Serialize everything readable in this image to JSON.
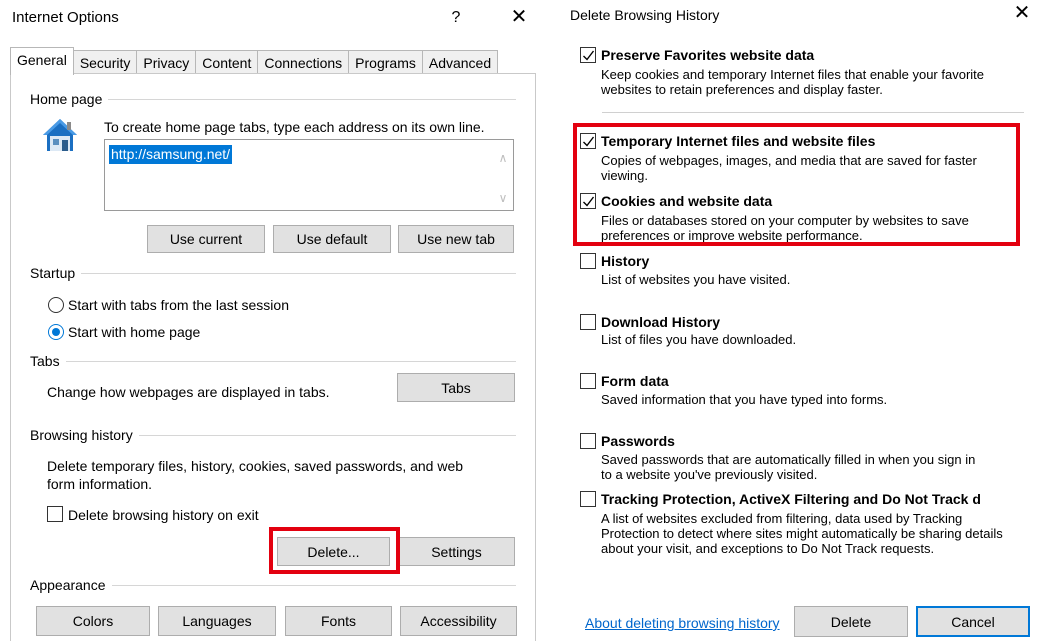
{
  "internet_options": {
    "title": "Internet Options",
    "help_glyph": "?",
    "close_glyph": "✕",
    "tabs": [
      {
        "label": "General"
      },
      {
        "label": "Security"
      },
      {
        "label": "Privacy"
      },
      {
        "label": "Content"
      },
      {
        "label": "Connections"
      },
      {
        "label": "Programs"
      },
      {
        "label": "Advanced"
      }
    ],
    "home_page": {
      "group_label": "Home page",
      "instruction": "To create home page tabs, type each address on its own line.",
      "url_value": "http://samsung.net/",
      "use_current": "Use current",
      "use_default": "Use default",
      "use_new_tab": "Use new tab"
    },
    "startup": {
      "group_label": "Startup",
      "option_last_session": "Start with tabs from the last session",
      "option_home_page": "Start with home page"
    },
    "tabs_group": {
      "group_label": "Tabs",
      "description": "Change how webpages are displayed in tabs.",
      "button": "Tabs"
    },
    "browsing_history": {
      "group_label": "Browsing history",
      "description_line1": "Delete temporary files, history, cookies, saved passwords, and web",
      "description_line2": "form information.",
      "delete_on_exit": "Delete browsing history on exit",
      "delete_button": "Delete...",
      "settings_button": "Settings"
    },
    "appearance": {
      "group_label": "Appearance",
      "colors": "Colors",
      "languages": "Languages",
      "fonts": "Fonts",
      "accessibility": "Accessibility"
    }
  },
  "delete_browsing_history": {
    "title": "Delete Browsing History",
    "close_glyph": "✕",
    "options": [
      {
        "label": "Preserve Favorites website data",
        "checked": true,
        "desc1": "Keep cookies and temporary Internet files that enable your favorite",
        "desc2": "websites to retain preferences and display faster."
      },
      {
        "label": "Temporary Internet files and website files",
        "checked": true,
        "desc1": "Copies of webpages, images, and media that are saved for faster",
        "desc2": "viewing."
      },
      {
        "label": "Cookies and website data",
        "checked": true,
        "desc1": "Files or databases stored on your computer by websites to save",
        "desc2": "preferences or improve website performance."
      },
      {
        "label": "History",
        "checked": false,
        "desc1": "List of websites you have visited.",
        "desc2": ""
      },
      {
        "label": "Download History",
        "checked": false,
        "desc1": "List of files you have downloaded.",
        "desc2": ""
      },
      {
        "label": "Form data",
        "checked": false,
        "desc1": "Saved information that you have typed into forms.",
        "desc2": ""
      },
      {
        "label": "Passwords",
        "checked": false,
        "desc1": "Saved passwords that are automatically filled in when you sign in",
        "desc2": "to a website you've previously visited."
      },
      {
        "label": "Tracking Protection, ActiveX Filtering and Do Not Track d",
        "checked": false,
        "desc1": "A list of websites excluded from filtering, data used by Tracking",
        "desc2": "Protection to detect where sites might automatically be sharing details",
        "desc3": "about your visit, and exceptions to Do Not Track requests."
      }
    ],
    "about_link": "About deleting browsing history",
    "delete_button": "Delete",
    "cancel_button": "Cancel"
  },
  "colors": {
    "highlight_red": "#e3000f",
    "selection_blue": "#0078d7",
    "link_blue": "#0066cc"
  }
}
